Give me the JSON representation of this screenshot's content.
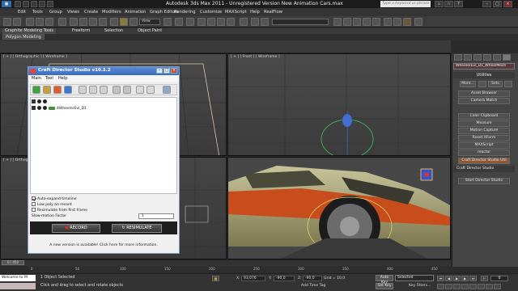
{
  "window": {
    "title": "Autodesk 3ds Max  2011  - Unregistered Version    New Animation Cars.max",
    "search_placeholder": "Type a keyword or phrase"
  },
  "menu": [
    "Edit",
    "Tools",
    "Group",
    "Views",
    "Create",
    "Modifiers",
    "Animation",
    "Graph Editors",
    "Rendering",
    "Customize",
    "MAXScript",
    "Help",
    "RealFlow"
  ],
  "toolbar": {
    "view_dropdown": "View"
  },
  "ribbon": {
    "tabs": [
      "Graphite Modeling Tools",
      "Freeform",
      "Selection",
      "Object Paint"
    ],
    "panel_label": "Polygon Modeling"
  },
  "viewports": {
    "top_label": "[ + ] [ Orthographic ] [ Wireframe ]",
    "front_label": "[ + ] [ Front ] [ Wireframe ]",
    "left_label": "[ + ] [ Orthographic ]"
  },
  "command_panel": {
    "object_name": "WheelerEvl_D1_WheelMesh",
    "utilities_title": "Utilities",
    "more_label": "More...",
    "sets_label": "Sets",
    "utilities": [
      "Asset Browser",
      "Camera Match",
      "Color Clipboard",
      "Measure",
      "Motion Capture",
      "Reset XForm",
      "MAXScript",
      "reactor",
      "Craft Director Studio Util"
    ],
    "cds_rollout": "Craft Director Studio",
    "start_button": "Start Director Studio"
  },
  "cds": {
    "title": "Craft Director Studio v10.1.2",
    "menu": [
      "Main",
      "Tool",
      "Help"
    ],
    "tree_row": "4WheelerEvl_D1",
    "options": {
      "auto_expand": "Auto-expand timeline",
      "low_poly": "Low poly on record",
      "resimulate_first": "Resimulate from first frame",
      "slowmo_label": "Slow-motion Factor",
      "slowmo_value": "1"
    },
    "record_label": "RECORD",
    "resimulate_label": "RESIMULATE",
    "footer": "A new version is available! Click here for more information."
  },
  "timeline": {
    "slider": "0 / 450",
    "ticks": [
      "0",
      "50",
      "100",
      "150",
      "200",
      "250",
      "300",
      "350",
      "400",
      "450"
    ]
  },
  "status": {
    "maxscript": "Welcome to M",
    "line1": "1 Object Selected",
    "line2": "Click and drag to select and rotate objects",
    "x_label": "X:",
    "x_value": "93,076",
    "y_label": "Y:",
    "y_value": "-90,0",
    "z_label": "Z:",
    "z_value": "-90,0",
    "grid": "Grid = 10,0",
    "add_time_tag": "Add Time Tag",
    "auto_key": "Auto Key",
    "set_key": "Set Key",
    "selected": "Selected",
    "key_filters": "Key Filters...",
    "frame": "0"
  },
  "colors": {
    "record_icon": "#e03020",
    "resim_icon": "#cfcfcf",
    "accent_active": "#8a5a3a"
  }
}
